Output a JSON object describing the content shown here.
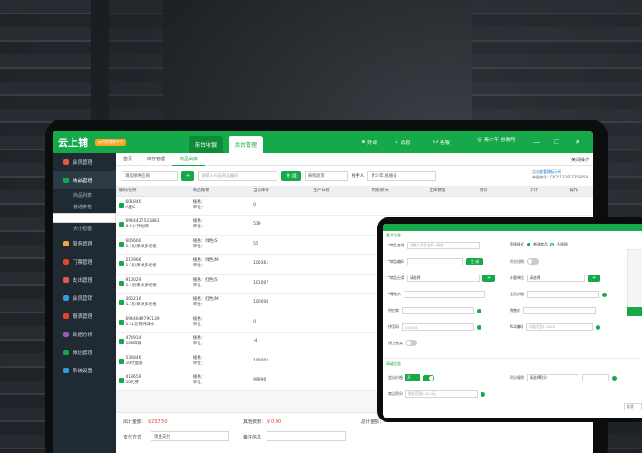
{
  "app": {
    "logo": "云上铺",
    "badge": "云供应管理平台",
    "btn_front": "前台收银",
    "btn_back": "后台管理",
    "links": [
      "外观",
      "消息",
      "客服"
    ],
    "user": "青少年-总账号"
  },
  "sidebar": {
    "items": [
      {
        "label": "会员管理",
        "color": "#e05a4b"
      },
      {
        "label": "商品管理",
        "color": "#16a94a"
      },
      {
        "label": "服务管理",
        "color": "#f3a43c"
      },
      {
        "label": "门票管理",
        "color": "#e0442b"
      },
      {
        "label": "支出管理",
        "color": "#e05a4b"
      },
      {
        "label": "会员营销",
        "color": "#2f9be0"
      },
      {
        "label": "报表管理",
        "color": "#e0442b"
      },
      {
        "label": "数据分析",
        "color": "#9b59b6"
      },
      {
        "label": "微信管理",
        "color": "#16a94a"
      },
      {
        "label": "系统设置",
        "color": "#2f9be0"
      }
    ],
    "subitems": [
      "商品列表",
      "普通表格",
      "库存管理",
      "大小包装"
    ]
  },
  "tabs": [
    "首页",
    "库存管理",
    "商品出库"
  ],
  "close_ops": "关闭操作",
  "toolbar": {
    "supplier_placeholder": "请选择供应商",
    "search_placeholder": "请输入扫描商品编码",
    "select_btn": "选 择",
    "purchase_return": "采购退货",
    "handler_label": "经手人",
    "handler_value": "青少年-总账号",
    "template_link": "点击查看模板示例",
    "order_no_label": "单据编号",
    "order_no": "CK25132817353859"
  },
  "table": {
    "headers": [
      "编码/名称",
      "商品规格",
      "当前库存",
      "生产日期",
      "保质期/天",
      "出库数量",
      "进价",
      "小计",
      "操作"
    ],
    "rows": [
      {
        "code": "601846",
        "name": "A型G",
        "spec": "规格：",
        "unit": "单位：",
        "stock": "0"
      },
      {
        "code": "6944437522881",
        "name": "0.5小神龙牌",
        "spec": "规格：",
        "unit": "单位：",
        "stock": "519"
      },
      {
        "code": "606660",
        "name": "1.1份果绿多规格",
        "spec": "规格：绿色|S",
        "unit": "单位：",
        "stock": "55"
      },
      {
        "code": "210966",
        "name": "1.1份果绿多规格",
        "spec": "规格：绿色|M",
        "unit": "单位：",
        "stock": "100361"
      },
      {
        "code": "910029",
        "name": "1.1份果绿多规格",
        "spec": "规格：红色|S",
        "unit": "单位：",
        "stock": "101007"
      },
      {
        "code": "305216",
        "name": "1.1份果绿多规格",
        "spec": "规格：红色|M",
        "unit": "单位：",
        "stock": "100000"
      },
      {
        "code": "6944649790139",
        "name": "1.5L饮用纯净水",
        "spec": "规格：",
        "unit": "单位：",
        "stock": "0"
      },
      {
        "code": "474914",
        "name": "108四联",
        "spec": "规格：",
        "unit": "单位：",
        "stock": "-4"
      },
      {
        "code": "534846",
        "name": "10寸蛋糕",
        "spec": "规格：",
        "unit": "单位：",
        "stock": "100002"
      },
      {
        "code": "418659",
        "name": "10元券",
        "spec": "规格：",
        "unit": "单位：",
        "stock": "99990"
      }
    ]
  },
  "footer": {
    "total_label": "出计金额：",
    "total": "￥237.50",
    "other_label": "其他费用：",
    "other": "￥0.00",
    "total2_label": "总计金额：",
    "pay_label": "支付方式",
    "pay_value": "现金支付",
    "remark_label": "备注信息"
  },
  "popup": {
    "section1": "基本信息",
    "name_label": "*商品名称",
    "name_ph": "请输入商品名称+规格",
    "code_label": "*商品编码",
    "gen_btn": "生 成",
    "cat_label": "*商品分类",
    "cat_ph": "请选择",
    "price_label": "*零售价",
    "supply_label": "供应商",
    "sale_label": "销售价",
    "pinyin_label": "拼音码",
    "mode_label": "管理模式",
    "mode_opts": [
      "普通商品",
      "多规格"
    ],
    "points_label": "积分比例",
    "unit_label": "计量单位",
    "unit_ph": "请选择",
    "cost_label": "会员价格",
    "stock_label": "库存",
    "plu_label": "PLU编码",
    "plu_ph": "取值范围1-4000",
    "shelf_label": "线上售卖",
    "section2": "高级信息",
    "member_label": "会员价格",
    "member_on": "开",
    "points_rule_label": "积分规则",
    "points_rule_ph": "请选择积分",
    "code_ph": "100128",
    "spec_label": "商品积分",
    "spec_ph": "取值范围0-10.2元",
    "cancel": "取消"
  }
}
